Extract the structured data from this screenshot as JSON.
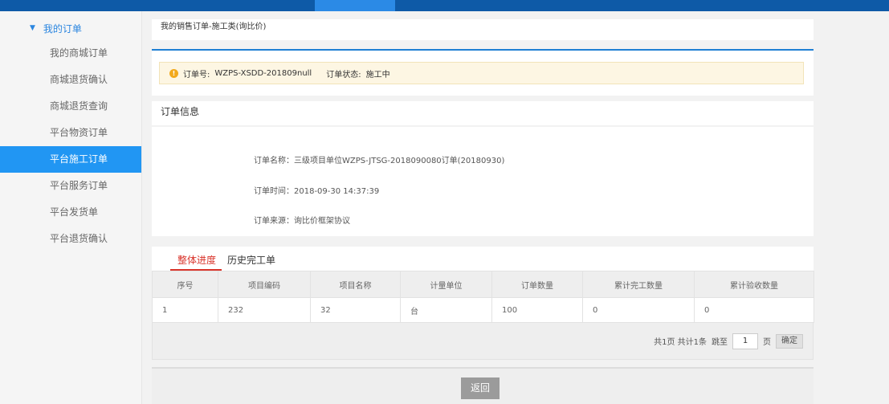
{
  "sidebar": {
    "header": "我的订单",
    "items": [
      {
        "label": "我的商城订单",
        "active": false
      },
      {
        "label": "商城退货确认",
        "active": false
      },
      {
        "label": "商城退货查询",
        "active": false
      },
      {
        "label": "平台物资订单",
        "active": false
      },
      {
        "label": "平台施工订单",
        "active": true
      },
      {
        "label": "平台服务订单",
        "active": false
      },
      {
        "label": "平台发货单",
        "active": false
      },
      {
        "label": "平台退货确认",
        "active": false
      }
    ]
  },
  "breadcrumb": "我的销售订单-施工类(询比价)",
  "notice": {
    "order_no_label": "订单号:",
    "order_no": "WZPS-XSDD-201809null",
    "status_label": "订单状态:",
    "status": "施工中"
  },
  "section_title": "订单信息",
  "info": {
    "name": "订单名称：三级项目单位WZPS-JTSG-2018090080订单(20180930)",
    "time": "订单时间：2018-09-30 14:37:39",
    "source": "订单来源：询比价框架协议"
  },
  "tabs": [
    {
      "label": "整体进度",
      "active": true
    },
    {
      "label": "历史完工单",
      "active": false
    }
  ],
  "table": {
    "headers": [
      "序号",
      "项目编码",
      "项目名称",
      "计量单位",
      "订单数量",
      "累计完工数量",
      "累计验收数量"
    ],
    "rows": [
      [
        "1",
        "232",
        "32",
        "台",
        "100",
        "0",
        "0"
      ]
    ]
  },
  "pager": {
    "summary": "共1页 共计1条",
    "goto_label": "跳至",
    "page_value": "1",
    "page_suffix": "页",
    "confirm": "确定"
  },
  "back_button": "返回",
  "colors": {
    "accent": "#2196f3",
    "active_tab": "#d9342b",
    "header_bar": "#0e5aa7"
  }
}
